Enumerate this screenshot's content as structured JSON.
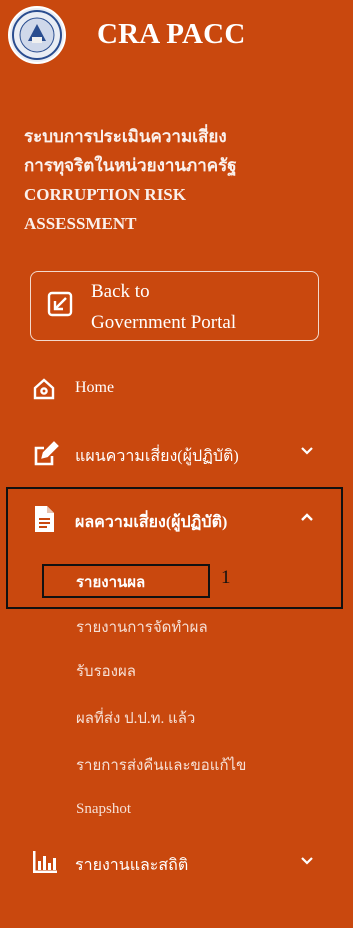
{
  "brand": {
    "name": "CRA PACC"
  },
  "subtitle": {
    "lines": [
      "ระบบการประเมินความเสี่ยง",
      "การทุจริตในหน่วยงานภาครัฐ",
      "CORRUPTION RISK",
      "ASSESSMENT"
    ]
  },
  "back_button": {
    "line1": "Back to",
    "line2": "Government Portal"
  },
  "nav": {
    "home": "Home",
    "risk_plan": "แผนความเสี่ยง(ผู้ปฏิบัติ)",
    "risk_result": "ผลความเสี่ยง(ผู้ปฏิบัติ)",
    "sub_items": [
      "รายงานผล",
      "รายงานการจัดทำผล",
      "รับรองผล",
      "ผลที่ส่ง ป.ป.ท. แล้ว",
      "รายการส่งคืนและขอแก้ไข",
      "Snapshot"
    ],
    "reports": "รายงานและสถิติ"
  },
  "annotation": "1",
  "colors": {
    "sidebar_bg": "#c9480e",
    "text": "#ffffff",
    "annotation_box": "#111111"
  }
}
